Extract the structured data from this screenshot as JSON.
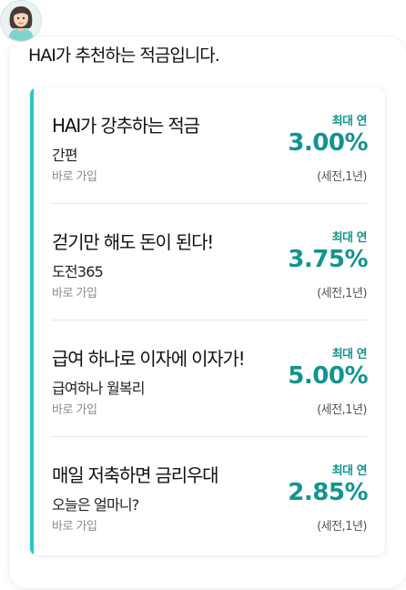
{
  "intro": "HAI가 추천하는 적금입니다.",
  "accent_color": "#2ec4c4",
  "rate_color": "#11948f",
  "avatar_icon": "woman-avatar-icon",
  "products": [
    {
      "title": "HAI가 강추하는 적금",
      "subtitle": "간편",
      "join": "바로 가입",
      "rate_label": "최대 연",
      "rate": "3.00%",
      "note": "(세전,1년)"
    },
    {
      "title": "걷기만 해도 돈이 된다!",
      "subtitle": "도전365",
      "join": "바로 가입",
      "rate_label": "최대 연",
      "rate": "3.75%",
      "note": "(세전,1년)"
    },
    {
      "title": "급여 하나로 이자에 이자가!",
      "subtitle": "급여하나 월복리",
      "join": "바로 가입",
      "rate_label": "최대 연",
      "rate": "5.00%",
      "note": "(세전,1년)"
    },
    {
      "title": "매일 저축하면 금리우대",
      "subtitle": "오늘은 얼마니?",
      "join": "바로 가입",
      "rate_label": "최대 연",
      "rate": "2.85%",
      "note": "(세전,1년)"
    }
  ]
}
